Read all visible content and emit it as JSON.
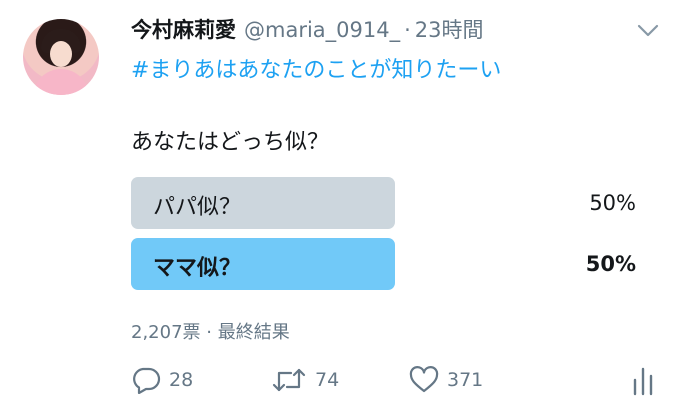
{
  "tweet": {
    "author_name": "今村麻莉愛",
    "handle": "@maria_0914_",
    "separator": "·",
    "time": "23時間",
    "hashtag": "#まりあはあなたのことが知りたーい",
    "text": "あなたはどっち似？"
  },
  "poll": {
    "options": [
      {
        "label": "パパ似？",
        "percent": "50%",
        "winner": false
      },
      {
        "label": "ママ似？",
        "percent": "50%",
        "winner": true
      }
    ],
    "summary": "2,207票 · 最終結果"
  },
  "actions": {
    "reply_count": "28",
    "retweet_count": "74",
    "like_count": "371"
  },
  "colors": {
    "accent": "#1da1f2",
    "secondary_text": "#657786",
    "poll_winner": "#71c9f8",
    "poll_other": "#ccd6dd"
  },
  "icons": [
    "chevron-down-icon",
    "reply-icon",
    "retweet-icon",
    "like-icon",
    "analytics-icon"
  ]
}
